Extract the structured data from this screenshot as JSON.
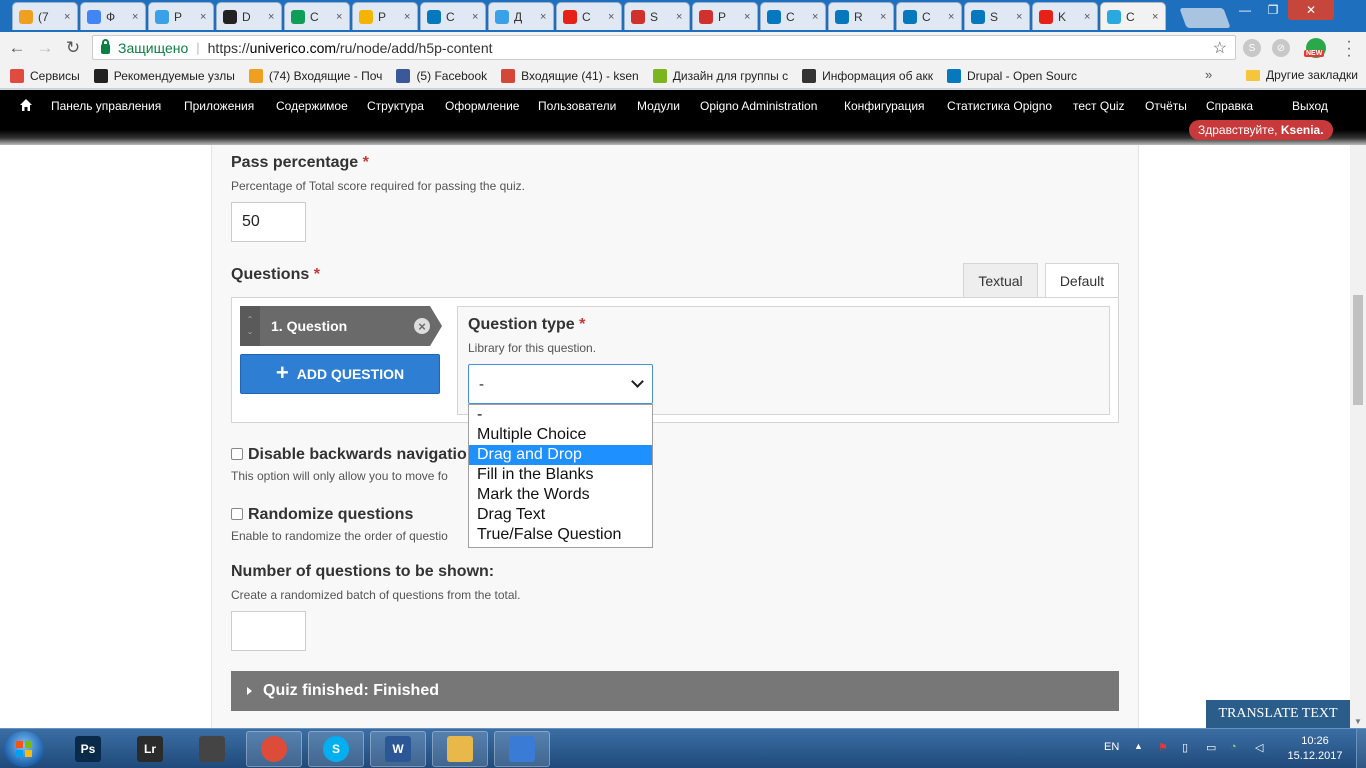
{
  "browser": {
    "tabs": [
      {
        "short": "(7",
        "icon": "mail-icon",
        "color": "#f0a020"
      },
      {
        "short": "Ф",
        "icon": "document-icon",
        "color": "#4285f4"
      },
      {
        "short": "Р",
        "icon": "circle-icon",
        "color": "#3aa0e8"
      },
      {
        "short": "D",
        "icon": "h5p-icon",
        "color": "#222222"
      },
      {
        "short": "C",
        "icon": "sheet-icon",
        "color": "#0f9d58"
      },
      {
        "short": "Р",
        "icon": "drive-icon",
        "color": "#f4b400"
      },
      {
        "short": "C",
        "icon": "drupal-icon",
        "color": "#0678be"
      },
      {
        "short": "Д",
        "icon": "circle-icon",
        "color": "#3aa0e8"
      },
      {
        "short": "C",
        "icon": "youtube-icon",
        "color": "#e62117"
      },
      {
        "short": "S",
        "icon": "sr-icon",
        "color": "#d0312d"
      },
      {
        "short": "Р",
        "icon": "sr-icon",
        "color": "#d0312d"
      },
      {
        "short": "C",
        "icon": "drupal-icon",
        "color": "#0678be"
      },
      {
        "short": "R",
        "icon": "drupal-icon",
        "color": "#0678be"
      },
      {
        "short": "C",
        "icon": "drupal-icon",
        "color": "#0678be"
      },
      {
        "short": "S",
        "icon": "drupal-icon",
        "color": "#0678be"
      },
      {
        "short": "K",
        "icon": "youtube-icon",
        "color": "#e62117"
      },
      {
        "short": "C",
        "icon": "univerico-icon",
        "color": "#29a9e0"
      }
    ],
    "tab_close": "×",
    "secure_label": "Защищено",
    "url_scheme": "https://",
    "url_host": "univerico.com",
    "url_path": "/ru/node/add/h5p-content",
    "new_badge": "NEW"
  },
  "bookmarks": {
    "items": [
      {
        "label": "Сервисы",
        "icon": "apps-icon",
        "color": "#e04a3f"
      },
      {
        "label": "Рекомендуемые узлы",
        "icon": "bing-icon",
        "color": "#222222"
      },
      {
        "label": "(74) Входящие - Поч",
        "icon": "mail-icon",
        "color": "#f0a020"
      },
      {
        "label": "(5) Facebook",
        "icon": "facebook-icon",
        "color": "#3b5998"
      },
      {
        "label": "Входящие (41) - ksen",
        "icon": "gmail-icon",
        "color": "#d44638"
      },
      {
        "label": "Дизайн для группы с",
        "icon": "ru-icon",
        "color": "#7ab51d"
      },
      {
        "label": "Информация об акк",
        "icon": "dh-icon",
        "color": "#333333"
      },
      {
        "label": "Drupal - Open Sourc",
        "icon": "drupal-icon",
        "color": "#0678be"
      }
    ],
    "more": "»",
    "other": "Другие закладки"
  },
  "admin_menu": {
    "items": [
      "Панель управления",
      "Приложения",
      "Содержимое",
      "Структура",
      "Оформление",
      "Пользователи",
      "Модули",
      "Opigno Administration",
      "Конфигурация",
      "Статистика Opigno",
      "тест Quiz",
      "Отчёты",
      "Справка",
      "Выход"
    ],
    "greeting": "Здравствуйте, ",
    "user": "Ksenia."
  },
  "form": {
    "pass_label": "Pass percentage",
    "required_mark": "*",
    "pass_desc": "Percentage of Total score required for passing the quiz.",
    "pass_value": "50",
    "questions_label": "Questions",
    "tab_textual": "Textual",
    "tab_default": "Default",
    "question_item": "1. Question",
    "add_question": "ADD QUESTION",
    "qtype_label": "Question type",
    "qtype_desc": "Library for this question.",
    "qtype_selected": "-",
    "qtype_options": [
      "-",
      "Multiple Choice",
      "Drag and Drop",
      "Fill in the Blanks",
      "Mark the Words",
      "Drag Text",
      "True/False Question"
    ],
    "qtype_highlighted": "Drag and Drop",
    "disable_back_label": "Disable backwards navigatio",
    "disable_back_desc": "This option will only allow you to move fo",
    "randomize_label": "Randomize questions",
    "randomize_desc": "Enable to randomize the order of questio",
    "num_shown_label": "Number of questions to be shown:",
    "num_shown_desc": "Create a randomized batch of questions from the total.",
    "num_shown_value": "",
    "quiz_finished": "Quiz finished: Finished"
  },
  "translate_button": "TRANSLATE TEXT",
  "taskbar": {
    "apps": [
      {
        "label": "Ps",
        "icon": "photoshop-icon",
        "color": "#0a2a4a"
      },
      {
        "label": "Lr",
        "icon": "lightroom-icon",
        "color": "#2b2b2b"
      },
      {
        "label": "",
        "icon": "camera-icon",
        "color": "#444444"
      },
      {
        "label": "",
        "icon": "chrome-icon",
        "color": "#dd4b39"
      },
      {
        "label": "S",
        "icon": "skype-icon",
        "color": "#00aff0"
      },
      {
        "label": "W",
        "icon": "word-icon",
        "color": "#2b5797"
      },
      {
        "label": "",
        "icon": "explorer-icon",
        "color": "#e8b84a"
      },
      {
        "label": "",
        "icon": "network-icon",
        "color": "#3a7bd5"
      }
    ],
    "language": "EN",
    "time": "10:26",
    "date": "15.12.2017"
  }
}
